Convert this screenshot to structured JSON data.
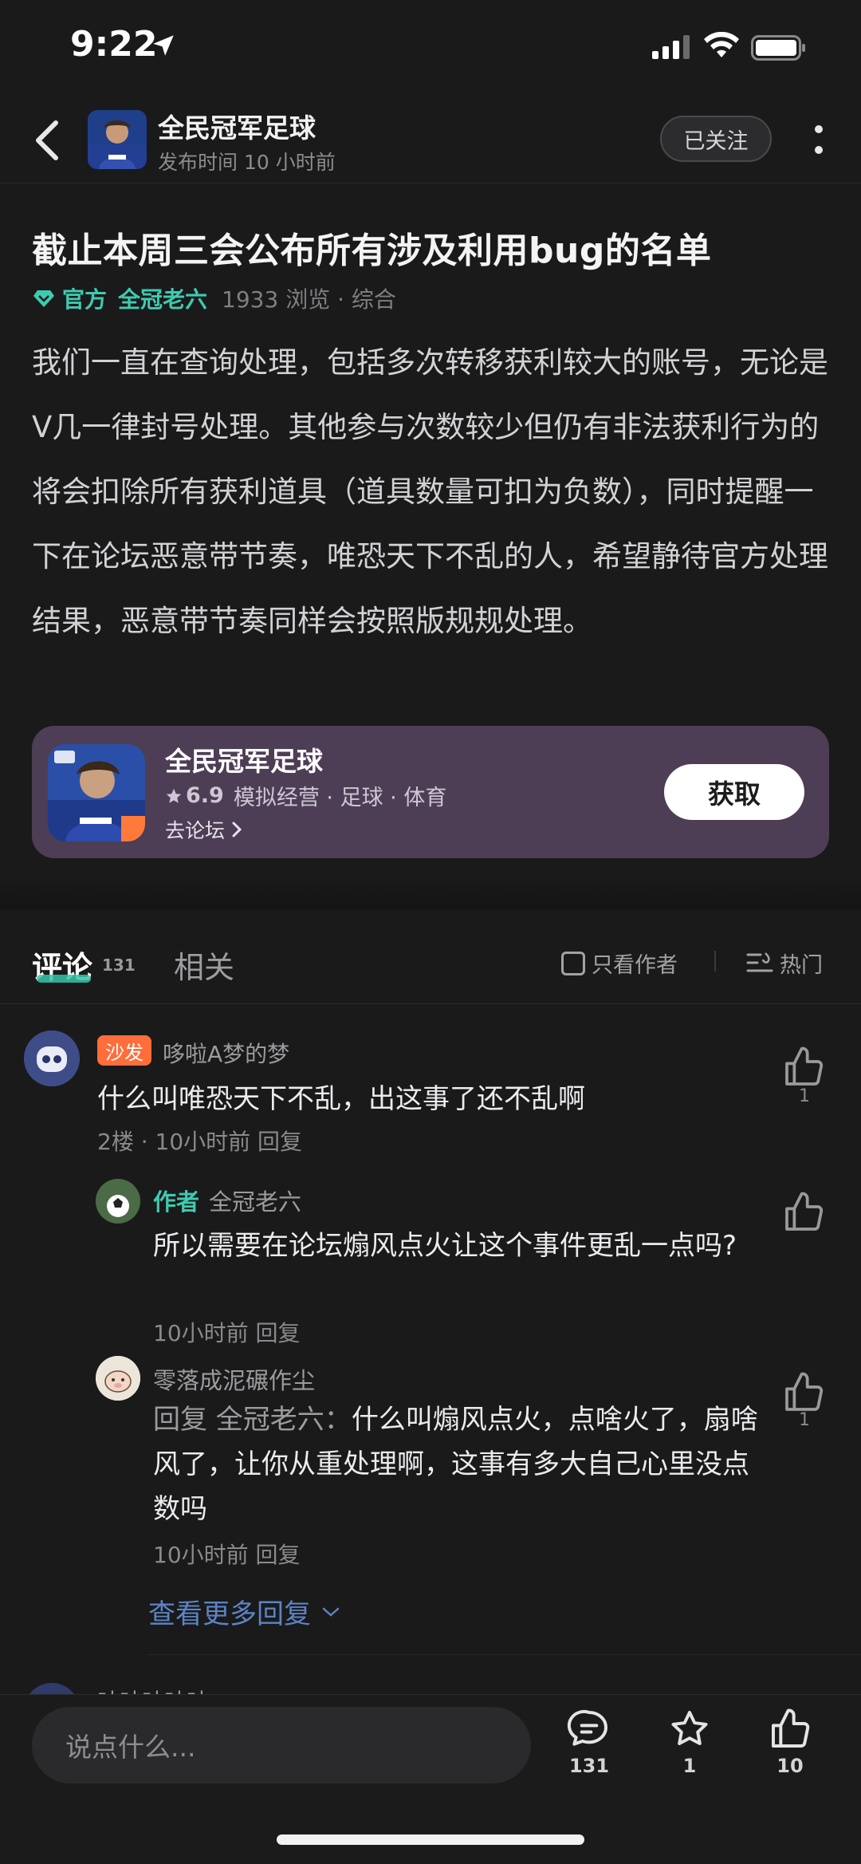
{
  "status_bar": {
    "time": "9:22"
  },
  "header": {
    "title": "全民冠军足球",
    "subtitle": "发布时间 10 小时前",
    "follow_label": "已关注"
  },
  "post": {
    "title": "截止本周三会公布所有涉及利用bug的名单",
    "official_label": "官方",
    "author": "全冠老六",
    "views": "1933 浏览 · 综合",
    "body": "我们一直在查询处理，包括多次转移获利较大的账号，无论是V几一律封号处理。其他参与次数较少但仍有非法获利行为的将会扣除所有获利道具（道具数量可扣为负数），同时提醒一下在论坛恶意带节奏，唯恐天下不乱的人，希望静待官方处理结果，恶意带节奏同样会按照版规规处理。"
  },
  "game_card": {
    "name": "全民冠军足球",
    "rating": "6.9",
    "tags": "模拟经营 · 足球 · 体育",
    "forum_link": "去论坛",
    "get_label": "获取"
  },
  "tabs": {
    "comments_label": "评论",
    "comments_count": "131",
    "related_label": "相关",
    "author_only_label": "只看作者",
    "sort_label": "热门"
  },
  "comments": [
    {
      "badge": "沙发",
      "user": "哆啦A梦的梦",
      "text": "什么叫唯恐天下不乱，出这事了还不乱啊",
      "meta": "2楼 · 10小时前  回复",
      "likes": "1",
      "replies": [
        {
          "tag": "作者",
          "user": "全冠老六",
          "text": "所以需要在论坛煽风点火让这个事件更乱一点吗?",
          "meta": "10小时前  回复"
        },
        {
          "user": "零落成泥碾作尘",
          "reply_prefix": "回复 全冠老六：",
          "text": "什么叫煽风点火，点啥火了，扇啥风了，让你从重处理啊，这事有多大自己心里没点数吗",
          "meta": "10小时前  回复",
          "likes": "1"
        }
      ],
      "more_replies_label": "查看更多回复"
    },
    {
      "user": "咕咕咕咕咕"
    }
  ],
  "bottom_bar": {
    "input_placeholder": "说点什么...",
    "comment_count": "131",
    "favorite_count": "1",
    "like_count": "10"
  },
  "colors": {
    "accent_teal": "#3ecbb0",
    "card_bg": "#4d3e55",
    "sofa_badge": "#ff6d3a",
    "link_blue": "#5c84c4"
  }
}
